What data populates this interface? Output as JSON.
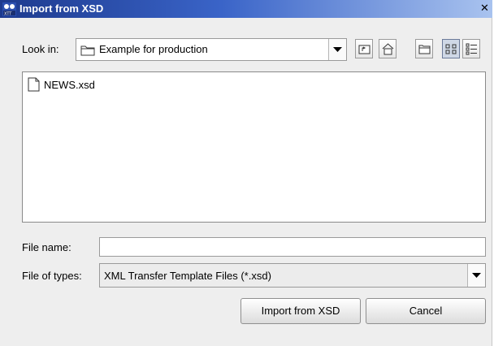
{
  "window": {
    "title": "Import from XSD",
    "close_glyph": "✕"
  },
  "look_in": {
    "label": "Look in:",
    "value": "Example for production",
    "toolbar": [
      "up-one-level-icon",
      "home-icon",
      "new-folder-icon",
      "list-view-icon",
      "details-view-icon"
    ]
  },
  "files": [
    {
      "name": "NEWS.xsd",
      "icon": "file-icon"
    }
  ],
  "file_name": {
    "label": "File name:",
    "value": "",
    "placeholder": ""
  },
  "file_types": {
    "label": "File of types:",
    "value": "XML Transfer Template Files (*.xsd)"
  },
  "buttons": {
    "import_label": "Import from XSD",
    "cancel_label": "Cancel"
  },
  "colors": {
    "title_bar_start": "#1d3a8e",
    "title_bar_end": "#a9c3ef",
    "dialog_bg": "#eeeeee"
  }
}
